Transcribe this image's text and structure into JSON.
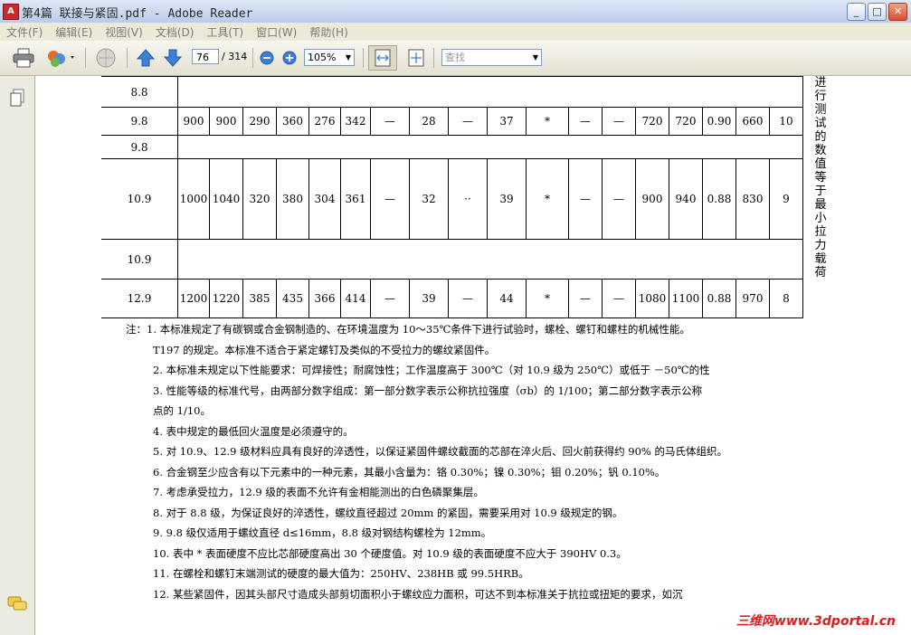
{
  "window": {
    "title": "第4篇 联接与紧固.pdf - Adobe Reader",
    "buttons": [
      "_",
      "□",
      "✕"
    ]
  },
  "menu": [
    "文件(F)",
    "编辑(E)",
    "视图(V)",
    "文档(D)",
    "工具(T)",
    "窗口(W)",
    "帮助(H)"
  ],
  "toolbar": {
    "page_current": "76",
    "page_total": "/ 314",
    "zoom": "105%",
    "search_placeholder": "查找"
  },
  "table": {
    "rows": [
      {
        "grade": "8.8",
        "cells": []
      },
      {
        "grade": "9.8",
        "cells": [
          "900",
          "900",
          "290",
          "360",
          "276",
          "342",
          "—",
          "28",
          "—",
          "37",
          "*",
          "—",
          "—",
          "720",
          "720",
          "0.90",
          "660",
          "10"
        ]
      },
      {
        "grade": "9.8",
        "cells": []
      },
      {
        "grade": "10.9",
        "cells": [
          "1000",
          "1040",
          "320",
          "380",
          "304",
          "361",
          "—",
          "32",
          "··",
          "39",
          "*",
          "—",
          "—",
          "900",
          "940",
          "0.88",
          "830",
          "9"
        ]
      },
      {
        "grade": "10.9",
        "cells": []
      },
      {
        "grade": "12.9",
        "cells": [
          "1200",
          "1220",
          "385",
          "435",
          "366",
          "414",
          "—",
          "39",
          "—",
          "44",
          "*",
          "—",
          "—",
          "1080",
          "1100",
          "0.88",
          "970",
          "8"
        ]
      }
    ],
    "side_text": [
      "进",
      "行",
      "测",
      "试",
      "的",
      "数",
      "值",
      "等",
      "于",
      "最",
      "小",
      "拉",
      "力",
      "载",
      "荷"
    ]
  },
  "notes": [
    {
      "text": "注：1. 本标准规定了有碳钢或合金钢制造的、在环境温度为 10～35℃条件下进行试验时，螺栓、螺钉和螺柱的机械性能。",
      "cls": ""
    },
    {
      "text": "T197 的规定。本标准不适合于紧定螺钉及类似的不受拉力的螺纹紧固件。",
      "cls": "indent"
    },
    {
      "text": "2. 本标准未规定以下性能要求：可焊接性；耐腐蚀性；工作温度高于 300℃（对 10.9 级为 250℃）或低于 －50℃的性",
      "cls": "sub"
    },
    {
      "text": "3. 性能等级的标准代号，由两部分数字组成：第一部分数字表示公称抗拉强度（σb）的 1/100；第二部分数字表示公称",
      "cls": "sub"
    },
    {
      "text": "点的 1/10。",
      "cls": "indent"
    },
    {
      "text": "4. 表中规定的最低回火温度是必须遵守的。",
      "cls": "sub"
    },
    {
      "text": "5. 对 10.9、12.9 级材料应具有良好的淬透性，以保证紧固件螺纹截面的芯部在淬火后、回火前获得约 90% 的马氏体组织。",
      "cls": "sub"
    },
    {
      "text": "6. 合金钢至少应含有以下元素中的一种元素，其最小含量为：铬 0.30%；镍 0.30%；钼 0.20%；钒 0.10%。",
      "cls": "sub"
    },
    {
      "text": "7. 考虑承受拉力，12.9 级的表面不允许有金相能测出的白色磷聚集层。",
      "cls": "sub"
    },
    {
      "text": "8. 对于 8.8 级，为保证良好的淬透性，螺纹直径超过 20mm 的紧固，需要采用对 10.9 级规定的钢。",
      "cls": "sub"
    },
    {
      "text": "9. 9.8 级仅适用于螺纹直径 d≤16mm，8.8 级对钢结构螺栓为 12mm。",
      "cls": "sub"
    },
    {
      "text": "10. 表中 * 表面硬度不应比芯部硬度高出 30 个硬度值。对 10.9 级的表面硬度不应大于 390HV 0.3。",
      "cls": "sub"
    },
    {
      "text": "11. 在螺栓和螺钉末端测试的硬度的最大值为：250HV、238HB 或 99.5HRB。",
      "cls": "sub"
    },
    {
      "text": "12. 某些紧固件，因其头部尺寸造成头部剪切面积小于螺纹应力面积，可达不到本标准关于抗拉或扭矩的要求，如沉",
      "cls": "sub"
    }
  ],
  "watermark": "三维网www.3dportal.cn"
}
